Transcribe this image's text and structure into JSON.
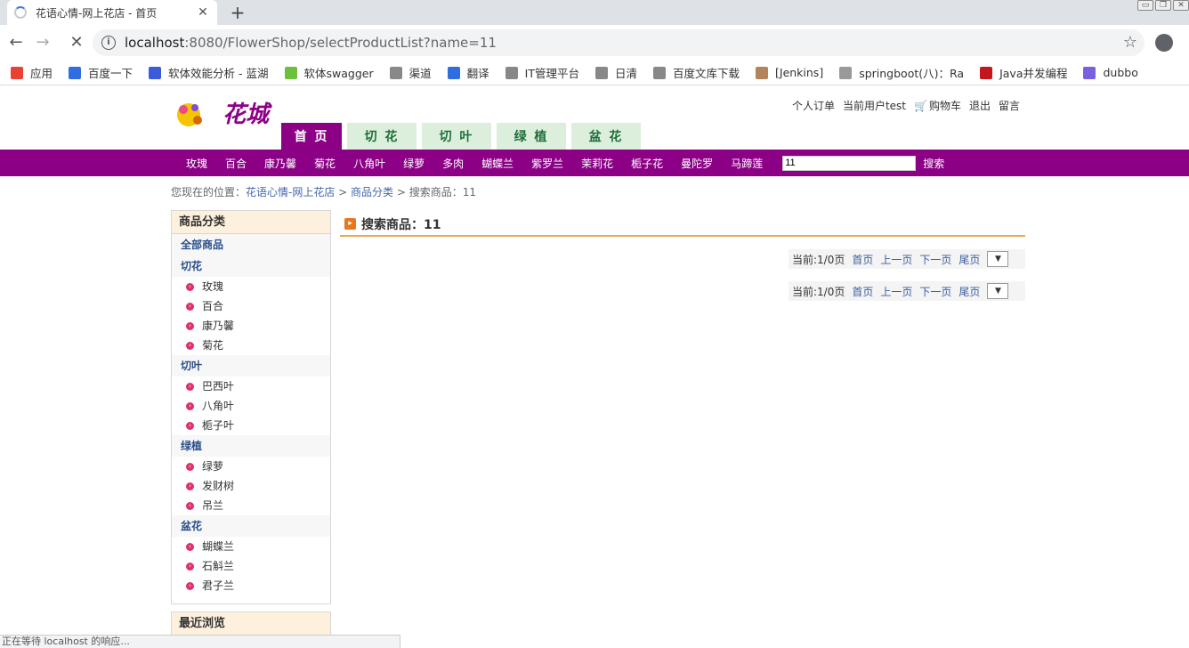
{
  "browser": {
    "tab_title": "花语心情-网上花店 - 首页",
    "url_host": "localhost",
    "url_path": ":8080/FlowerShop/selectProductList?name=11",
    "bookmarks": [
      {
        "label": "应用",
        "icon": "apps-icon",
        "color": "#e94235"
      },
      {
        "label": "百度一下",
        "icon": "baidu-icon",
        "color": "#2f6de1"
      },
      {
        "label": "软体效能分析 - 蓝湖",
        "icon": "lanhu-icon",
        "color": "#3b5bdb"
      },
      {
        "label": "软体swagger",
        "icon": "swagger-icon",
        "color": "#6fbf3e"
      },
      {
        "label": "渠道",
        "icon": "page-icon",
        "color": "#888888"
      },
      {
        "label": "翻译",
        "icon": "translate-icon",
        "color": "#2f6de1"
      },
      {
        "label": "IT管理平台",
        "icon": "page-icon",
        "color": "#888888"
      },
      {
        "label": "日清",
        "icon": "page-icon",
        "color": "#888888"
      },
      {
        "label": "百度文库下载",
        "icon": "page-icon",
        "color": "#888888"
      },
      {
        "label": "[Jenkins]",
        "icon": "jenkins-icon",
        "color": "#b5835a"
      },
      {
        "label": "springboot(八)：Ra",
        "icon": "globe-icon",
        "color": "#999999"
      },
      {
        "label": "Java并发编程",
        "icon": "csdn-icon",
        "color": "#c4161c"
      },
      {
        "label": "dubbo",
        "icon": "dubbo-icon",
        "color": "#7b5fe0"
      }
    ],
    "status_text": "正在等待 localhost 的响应..."
  },
  "header": {
    "logo_text": "花城",
    "links": {
      "orders": "个人订单",
      "current_user": "当前用户test",
      "cart": "购物车",
      "logout": "退出",
      "message": "留言"
    },
    "nav_tabs": [
      "首 页",
      "切 花",
      "切 叶",
      "绿 植",
      "盆 花"
    ]
  },
  "catbar": {
    "categories": [
      "玫瑰",
      "百合",
      "康乃馨",
      "菊花",
      "八角叶",
      "绿萝",
      "多肉",
      "蝴蝶兰",
      "紫罗兰",
      "茉莉花",
      "栀子花",
      "曼陀罗",
      "马蹄莲"
    ],
    "search_value": "11",
    "search_button": "搜索"
  },
  "breadcrumb": {
    "prefix": "您现在的位置：",
    "home": "花语心情-网上花店",
    "sep1": " > ",
    "category": "商品分类",
    "sep2": " > ",
    "current": "搜索商品：11"
  },
  "sidebar": {
    "title": "商品分类",
    "all": "全部商品",
    "groups": [
      {
        "name": "切花",
        "items": [
          "玫瑰",
          "百合",
          "康乃馨",
          "菊花"
        ]
      },
      {
        "name": "切叶",
        "items": [
          "巴西叶",
          "八角叶",
          "栀子叶"
        ]
      },
      {
        "name": "绿植",
        "items": [
          "绿萝",
          "发财树",
          "吊兰"
        ]
      },
      {
        "name": "盆花",
        "items": [
          "蝴蝶兰",
          "石斛兰",
          "君子兰"
        ]
      }
    ],
    "recent_title": "最近浏览"
  },
  "main": {
    "title": "搜索商品：11",
    "pager": {
      "current": "当前:1/0页",
      "first": "首页",
      "prev": "上一页",
      "next": "下一页",
      "last": "尾页"
    }
  }
}
